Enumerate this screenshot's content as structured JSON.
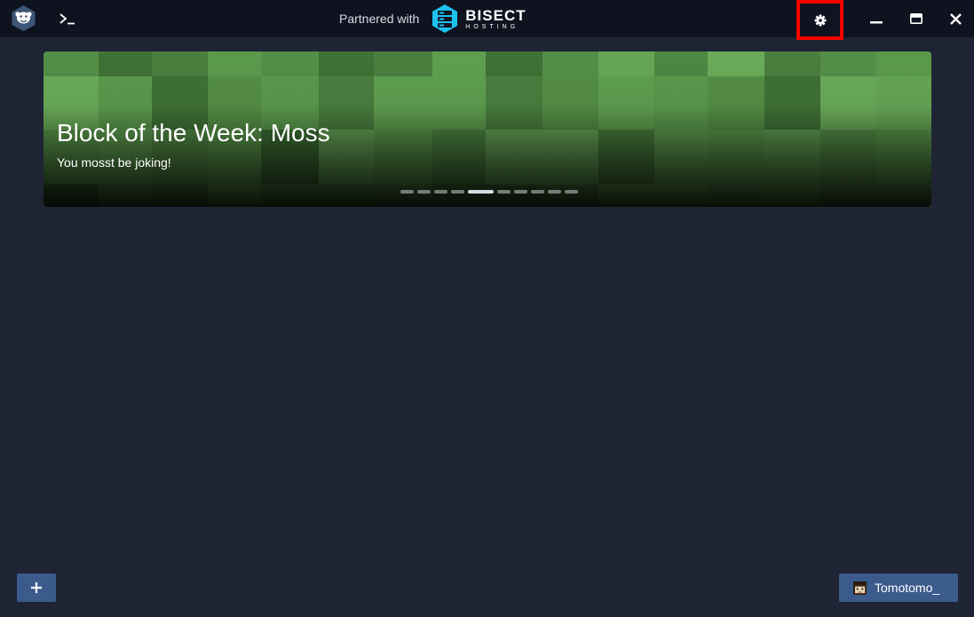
{
  "titlebar": {
    "partner_text": "Partnered with",
    "partner_brand": "BISECT",
    "partner_brand_sub": "HOSTING",
    "icons": {
      "logo": "monkey-logo",
      "terminal": "terminal-icon",
      "settings": "gear-icon",
      "minimize": "minimize-icon",
      "maximize": "maximize-icon",
      "close": "close-icon"
    }
  },
  "banner": {
    "title": "Block of the Week: Moss",
    "subtitle": "You mosst be joking!",
    "slide_count": 10,
    "active_slide": 5
  },
  "footer": {
    "add_icon": "plus-icon",
    "account_name": "Tomotomo_"
  },
  "colors": {
    "background": "#1e2433",
    "titlebar": "#0f1320",
    "button": "#3b5b8c",
    "highlight": "#ff0000",
    "brand": "#1cc2ee"
  }
}
